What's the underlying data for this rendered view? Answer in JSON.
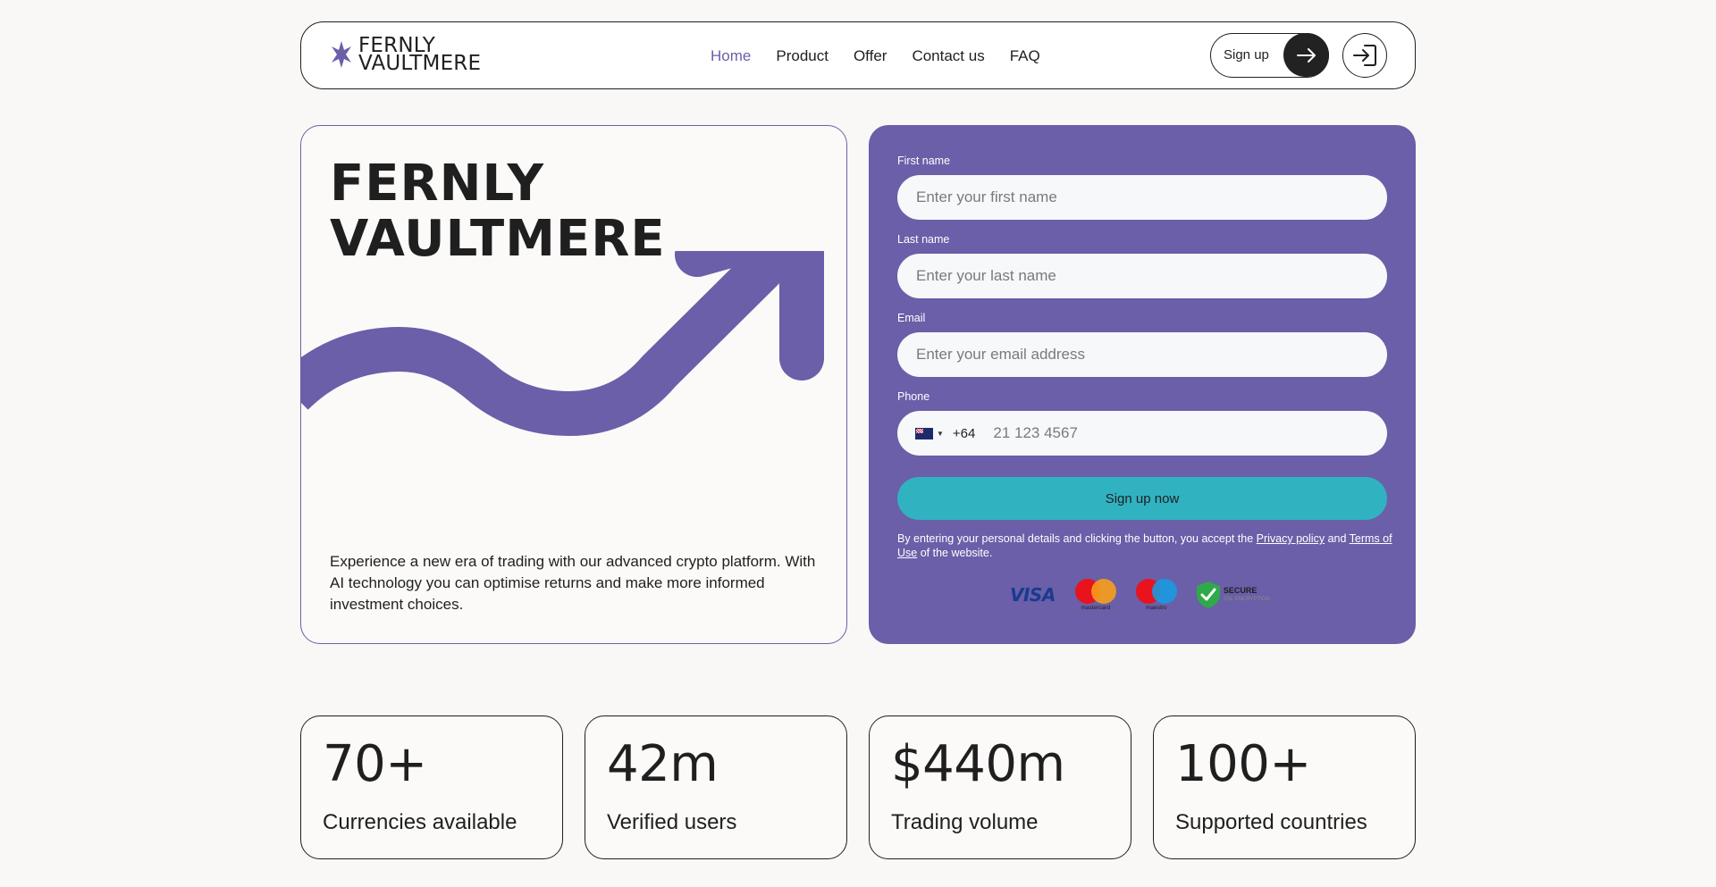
{
  "brand": {
    "line1": "FERNLY",
    "line2": "VAULTMERE"
  },
  "nav": {
    "links": [
      "Home",
      "Product",
      "Offer",
      "Contact us",
      "FAQ"
    ],
    "active": "Home",
    "signup_label": "Sign up"
  },
  "hero": {
    "title_line1": "FERNLY",
    "title_line2": "VAULTMERE",
    "description": "Experience a new era of trading with our advanced crypto platform. With AI technology you can optimise returns and make more informed investment choices."
  },
  "form": {
    "first_name": {
      "label": "First name",
      "placeholder": "Enter your first name"
    },
    "last_name": {
      "label": "Last name",
      "placeholder": "Enter your last name"
    },
    "email": {
      "label": "Email",
      "placeholder": "Enter your email address"
    },
    "phone": {
      "label": "Phone",
      "country_code": "+64",
      "placeholder": "21 123 4567"
    },
    "submit_label": "Sign up now",
    "terms": {
      "prefix": "By entering your personal details and clicking the button, you accept the",
      "privacy_link": "Privacy policy",
      "and": "and",
      "terms_link": "Terms of Use",
      "suffix": "of the website."
    },
    "payments": {
      "visa": "VISA",
      "mastercard": "mastercard",
      "maestro": "maestro",
      "secure_title": "SECURE",
      "secure_sub": "SSL ENCRYPTION"
    }
  },
  "stats": [
    {
      "value": "70+",
      "label": "Currencies available"
    },
    {
      "value": "42m",
      "label": "Verified users"
    },
    {
      "value": "$440m",
      "label": "Trading volume"
    },
    {
      "value": "100+",
      "label": "Supported countries"
    }
  ],
  "colors": {
    "accent": "#6a5fa8",
    "cta": "#31b2c1",
    "dark": "#1f1f1f",
    "background": "#faf8f6"
  }
}
